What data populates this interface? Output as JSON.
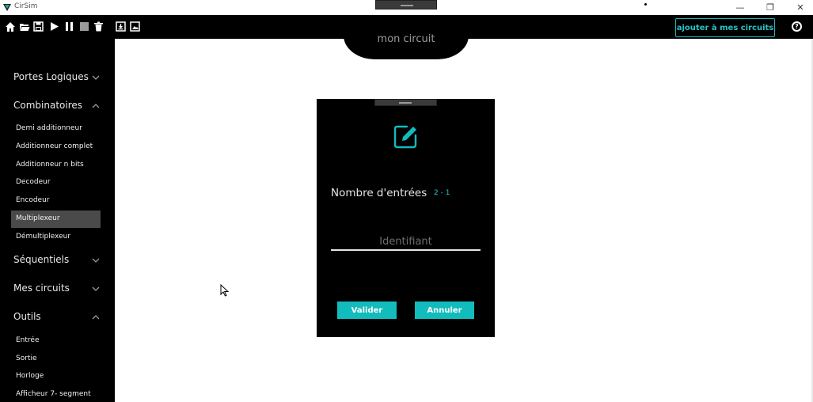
{
  "window": {
    "title": "CirSim",
    "controls": {
      "minimize": "—",
      "restore": "❐",
      "close": "✕"
    }
  },
  "toolbar": {
    "icons": [
      "home-icon",
      "open-folder-icon",
      "save-icon",
      "play-icon",
      "pause-icon",
      "stop-icon",
      "trash-icon",
      "import-icon",
      "image-icon"
    ],
    "add_button_label": "ajouter à mes circuits",
    "help_label": "?"
  },
  "sidebar": {
    "categories": [
      {
        "label": "Portes Logiques",
        "expanded": false
      },
      {
        "label": "Combinatoires",
        "expanded": true,
        "items": [
          "Demi additionneur",
          "Additionneur complet",
          "Additionneur n bits",
          "Decodeur",
          "Encodeur",
          "Multiplexeur",
          "Démultiplexeur"
        ],
        "selected": "Multiplexeur"
      },
      {
        "label": "Séquentiels",
        "expanded": false
      },
      {
        "label": "Mes circuits",
        "expanded": false
      },
      {
        "label": "Outils",
        "expanded": true,
        "items": [
          "Entrée",
          "Sortie",
          "Horloge",
          "Afficheur 7- segment"
        ]
      }
    ]
  },
  "canvas": {
    "circuit_name": "mon circuit"
  },
  "dialog": {
    "inputs_label": "Nombre d'entrées",
    "inputs_range": "2 - 1",
    "identifier_placeholder": "Identifiant",
    "identifier_value": "",
    "validate_label": "Valider",
    "cancel_label": "Annuler"
  },
  "colors": {
    "accent": "#12bcbc",
    "background_dark": "#000000",
    "selected_item": "#4a4a4a"
  }
}
